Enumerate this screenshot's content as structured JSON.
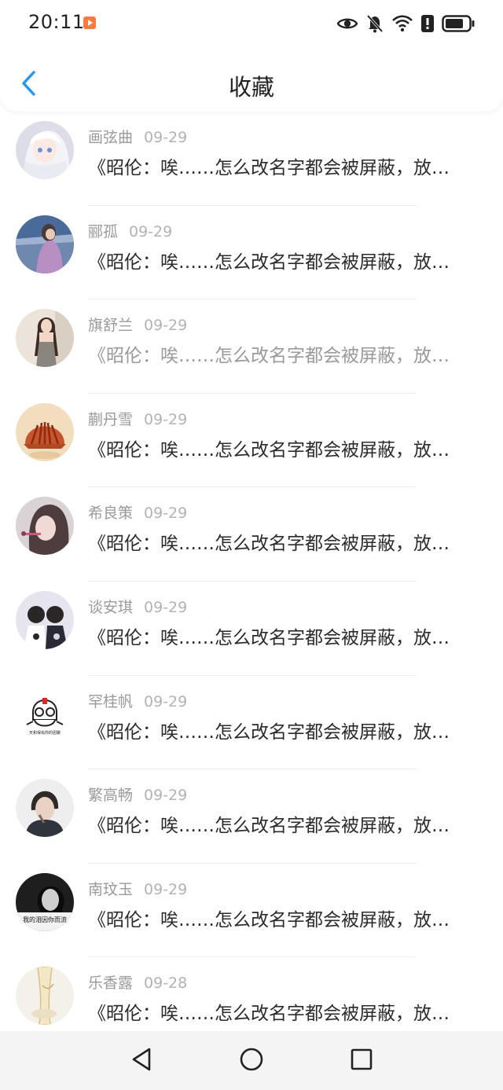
{
  "status_bar": {
    "time": "20:11",
    "icons": [
      "app-notification-icon",
      "eye-icon",
      "mute-icon",
      "wifi-icon",
      "alert-icon",
      "battery-icon"
    ]
  },
  "header": {
    "title": "收藏",
    "back_icon": "chevron-left-icon",
    "accent_color": "#2196F3"
  },
  "items": [
    {
      "name": "画弦曲",
      "date": "09-29",
      "text": "《昭伦：唉……怎么改名字都会被屏蔽，放…"
    },
    {
      "name": "郦孤",
      "date": "09-29",
      "text": "《昭伦：唉……怎么改名字都会被屏蔽，放…"
    },
    {
      "name": "旗舒兰",
      "date": "09-29",
      "text": "《昭伦：唉……怎么改名字都会被屏蔽，放…"
    },
    {
      "name": "蒯丹雪",
      "date": "09-29",
      "text": "《昭伦：唉……怎么改名字都会被屏蔽，放…"
    },
    {
      "name": "希良策",
      "date": "09-29",
      "text": "《昭伦：唉……怎么改名字都会被屏蔽，放…"
    },
    {
      "name": "谈安琪",
      "date": "09-29",
      "text": "《昭伦：唉……怎么改名字都会被屏蔽，放…"
    },
    {
      "name": "罕桂帆",
      "date": "09-29",
      "text": "《昭伦：唉……怎么改名字都会被屏蔽，放…"
    },
    {
      "name": "繁高畅",
      "date": "09-29",
      "text": "《昭伦：唉……怎么改名字都会被屏蔽，放…"
    },
    {
      "name": "南玟玉",
      "date": "09-29",
      "text": "《昭伦：唉……怎么改名字都会被屏蔽，放…"
    },
    {
      "name": "乐香露",
      "date": "09-28",
      "text": "《昭伦：唉……怎么改名字都会被屏蔽，放…"
    }
  ],
  "avatar_text": {
    "ghost_caption": "天和保佑你的团聚",
    "tears_caption": "我的泪因你而流"
  },
  "system_nav": [
    "back-triangle-icon",
    "home-circle-icon",
    "recents-square-icon"
  ]
}
